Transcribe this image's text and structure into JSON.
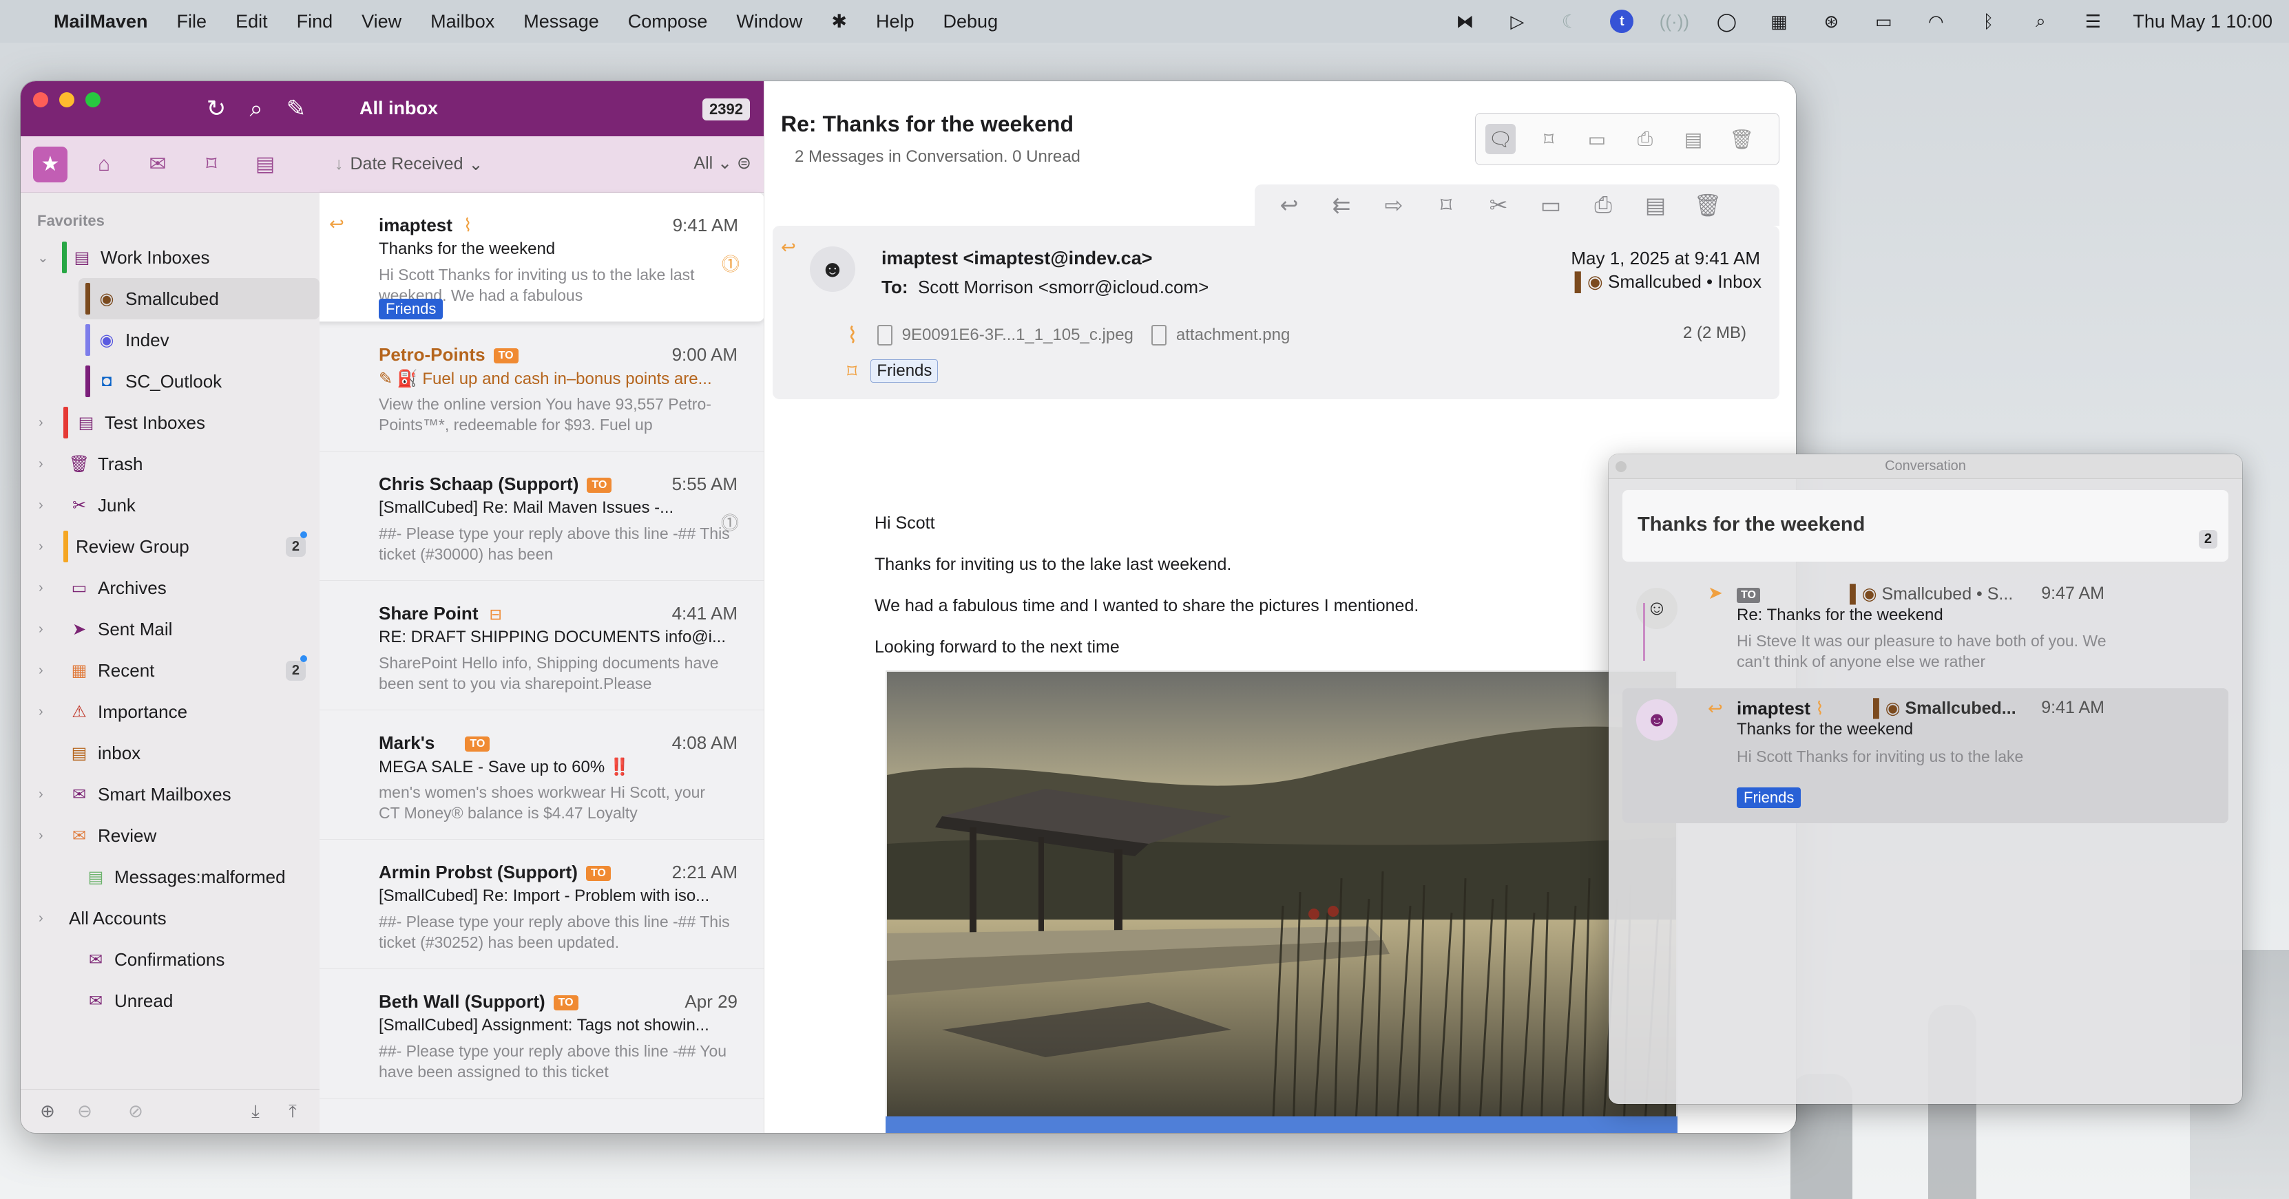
{
  "menubar": {
    "app": "MailMaven",
    "items": [
      "File",
      "Edit",
      "Find",
      "View",
      "Mailbox",
      "Message",
      "Compose",
      "Window",
      "Help",
      "Debug"
    ],
    "clock": "Thu May 1  10:00",
    "tbadge": "t"
  },
  "sidebar": {
    "section": "Favorites",
    "items": [
      {
        "label": "Work Inboxes",
        "color": "#28a745"
      },
      {
        "label": "Smallcubed",
        "color": "#7b4a1e"
      },
      {
        "label": "Indev",
        "color": "#7d7dea"
      },
      {
        "label": "SC_Outlook",
        "color": "#7b1f7a"
      },
      {
        "label": "Test Inboxes",
        "color": "#e53935"
      },
      {
        "label": "Trash"
      },
      {
        "label": "Junk"
      },
      {
        "label": "Review Group",
        "color": "#f5a623",
        "badge": "2"
      },
      {
        "label": "Archives"
      },
      {
        "label": "Sent Mail"
      },
      {
        "label": "Recent",
        "badge": "2"
      },
      {
        "label": "Importance"
      },
      {
        "label": "inbox"
      },
      {
        "label": "Smart Mailboxes"
      },
      {
        "label": "Review"
      },
      {
        "label": "Messages:malformed"
      },
      {
        "label": "All Accounts"
      },
      {
        "label": "Confirmations"
      },
      {
        "label": "Unread"
      }
    ]
  },
  "list": {
    "title": "All inbox",
    "count": "2392",
    "sort": "Date Received",
    "filter": "All",
    "messages": [
      {
        "from": "imaptest",
        "time": "9:41 AM",
        "subject": "Thanks for the weekend",
        "preview": "Hi Scott Thanks for inviting us to the lake last weekend. We had a fabulous",
        "tag": "Friends"
      },
      {
        "from": "Petro-Points",
        "badge": "TO",
        "time": "9:00 AM",
        "subject": "Fuel up and cash in–bonus points are...",
        "preview": "View the online version You have 93,557 Petro-Points™*, redeemable for $93. Fuel up"
      },
      {
        "from": "Chris Schaap (Support)",
        "badge": "TO",
        "time": "5:55 AM",
        "subject": "[SmallCubed] Re: Mail Maven Issues -...",
        "preview": "##- Please type your reply above this line -## This ticket (#30000) has been"
      },
      {
        "from": "Share Point",
        "time": "4:41 AM",
        "subject": "RE: DRAFT SHIPPING DOCUMENTS  info@i...",
        "preview": "SharePoint Hello info, Shipping documents have been sent to you via sharepoint.Please"
      },
      {
        "from": "Mark's",
        "badge": "TO",
        "time": "4:08 AM",
        "subject": "MEGA SALE - Save up to 60% ‼️",
        "preview": "men's women's shoes workwear Hi Scott, your CT Money® balance is $4.47 Loyalty"
      },
      {
        "from": "Armin Probst (Support)",
        "badge": "TO",
        "time": "2:21 AM",
        "subject": "[SmallCubed] Re: Import - Problem with iso...",
        "preview": "##- Please type your reply above this line -## This ticket (#30252) has been updated."
      },
      {
        "from": "Beth Wall (Support)",
        "badge": "TO",
        "time": "Apr 29",
        "subject": "[SmallCubed] Assignment: Tags not showin...",
        "preview": "##- Please type your reply above this line -## You have been assigned to this ticket"
      }
    ]
  },
  "reader": {
    "title": "Re: Thanks for the weekend",
    "subtitle": "2 Messages in Conversation. 0 Unread",
    "from": "imaptest <imaptest@indev.ca>",
    "to_label": "To:",
    "to": "Scott Morrison <smorr@icloud.com>",
    "date": "May 1, 2025 at 9:41 AM",
    "mailbox": "Smallcubed • Inbox",
    "attachments": [
      "9E0091E6-3F...1_1_105_c.jpeg",
      "attachment.png"
    ],
    "attach_size": "2 (2 MB)",
    "tag": "Friends",
    "body": [
      "Hi Scott",
      "Thanks for inviting us to the lake last weekend.",
      "We had a fabulous time and I wanted to share the pictures I mentioned.",
      "Looking forward to the next time"
    ]
  },
  "conversation": {
    "window_title": "Conversation",
    "title": "Thanks for the weekend",
    "count": "2",
    "items": [
      {
        "badge": "TO",
        "mailbox": "Smallcubed • S...",
        "time": "9:47 AM",
        "subject": "Re: Thanks for the weekend",
        "preview": "Hi Steve It was our pleasure to have both of you. We can't think of anyone else we rather"
      },
      {
        "from": "imaptest",
        "mailbox": "Smallcubed...",
        "time": "9:41 AM",
        "subject": "Thanks for the weekend",
        "preview": "Hi Scott Thanks for inviting us to the lake",
        "tag": "Friends"
      }
    ]
  }
}
